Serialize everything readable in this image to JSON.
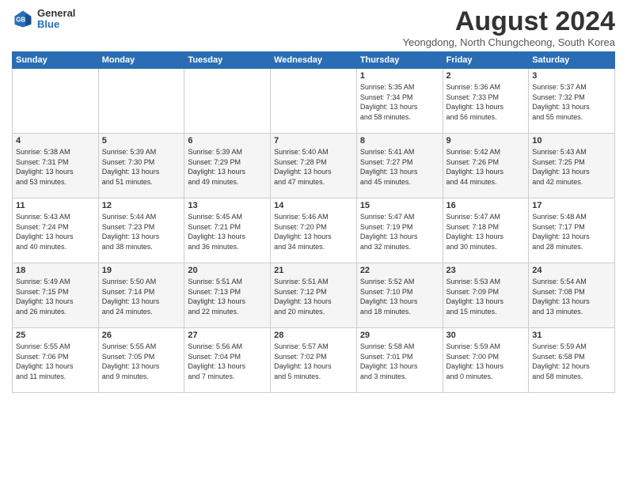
{
  "logo": {
    "general": "General",
    "blue": "Blue"
  },
  "header": {
    "title": "August 2024",
    "subtitle": "Yeongdong, North Chungcheong, South Korea"
  },
  "weekdays": [
    "Sunday",
    "Monday",
    "Tuesday",
    "Wednesday",
    "Thursday",
    "Friday",
    "Saturday"
  ],
  "weeks": [
    [
      {
        "day": "",
        "info": ""
      },
      {
        "day": "",
        "info": ""
      },
      {
        "day": "",
        "info": ""
      },
      {
        "day": "",
        "info": ""
      },
      {
        "day": "1",
        "info": "Sunrise: 5:35 AM\nSunset: 7:34 PM\nDaylight: 13 hours\nand 58 minutes."
      },
      {
        "day": "2",
        "info": "Sunrise: 5:36 AM\nSunset: 7:33 PM\nDaylight: 13 hours\nand 56 minutes."
      },
      {
        "day": "3",
        "info": "Sunrise: 5:37 AM\nSunset: 7:32 PM\nDaylight: 13 hours\nand 55 minutes."
      }
    ],
    [
      {
        "day": "4",
        "info": "Sunrise: 5:38 AM\nSunset: 7:31 PM\nDaylight: 13 hours\nand 53 minutes."
      },
      {
        "day": "5",
        "info": "Sunrise: 5:39 AM\nSunset: 7:30 PM\nDaylight: 13 hours\nand 51 minutes."
      },
      {
        "day": "6",
        "info": "Sunrise: 5:39 AM\nSunset: 7:29 PM\nDaylight: 13 hours\nand 49 minutes."
      },
      {
        "day": "7",
        "info": "Sunrise: 5:40 AM\nSunset: 7:28 PM\nDaylight: 13 hours\nand 47 minutes."
      },
      {
        "day": "8",
        "info": "Sunrise: 5:41 AM\nSunset: 7:27 PM\nDaylight: 13 hours\nand 45 minutes."
      },
      {
        "day": "9",
        "info": "Sunrise: 5:42 AM\nSunset: 7:26 PM\nDaylight: 13 hours\nand 44 minutes."
      },
      {
        "day": "10",
        "info": "Sunrise: 5:43 AM\nSunset: 7:25 PM\nDaylight: 13 hours\nand 42 minutes."
      }
    ],
    [
      {
        "day": "11",
        "info": "Sunrise: 5:43 AM\nSunset: 7:24 PM\nDaylight: 13 hours\nand 40 minutes."
      },
      {
        "day": "12",
        "info": "Sunrise: 5:44 AM\nSunset: 7:23 PM\nDaylight: 13 hours\nand 38 minutes."
      },
      {
        "day": "13",
        "info": "Sunrise: 5:45 AM\nSunset: 7:21 PM\nDaylight: 13 hours\nand 36 minutes."
      },
      {
        "day": "14",
        "info": "Sunrise: 5:46 AM\nSunset: 7:20 PM\nDaylight: 13 hours\nand 34 minutes."
      },
      {
        "day": "15",
        "info": "Sunrise: 5:47 AM\nSunset: 7:19 PM\nDaylight: 13 hours\nand 32 minutes."
      },
      {
        "day": "16",
        "info": "Sunrise: 5:47 AM\nSunset: 7:18 PM\nDaylight: 13 hours\nand 30 minutes."
      },
      {
        "day": "17",
        "info": "Sunrise: 5:48 AM\nSunset: 7:17 PM\nDaylight: 13 hours\nand 28 minutes."
      }
    ],
    [
      {
        "day": "18",
        "info": "Sunrise: 5:49 AM\nSunset: 7:15 PM\nDaylight: 13 hours\nand 26 minutes."
      },
      {
        "day": "19",
        "info": "Sunrise: 5:50 AM\nSunset: 7:14 PM\nDaylight: 13 hours\nand 24 minutes."
      },
      {
        "day": "20",
        "info": "Sunrise: 5:51 AM\nSunset: 7:13 PM\nDaylight: 13 hours\nand 22 minutes."
      },
      {
        "day": "21",
        "info": "Sunrise: 5:51 AM\nSunset: 7:12 PM\nDaylight: 13 hours\nand 20 minutes."
      },
      {
        "day": "22",
        "info": "Sunrise: 5:52 AM\nSunset: 7:10 PM\nDaylight: 13 hours\nand 18 minutes."
      },
      {
        "day": "23",
        "info": "Sunrise: 5:53 AM\nSunset: 7:09 PM\nDaylight: 13 hours\nand 15 minutes."
      },
      {
        "day": "24",
        "info": "Sunrise: 5:54 AM\nSunset: 7:08 PM\nDaylight: 13 hours\nand 13 minutes."
      }
    ],
    [
      {
        "day": "25",
        "info": "Sunrise: 5:55 AM\nSunset: 7:06 PM\nDaylight: 13 hours\nand 11 minutes."
      },
      {
        "day": "26",
        "info": "Sunrise: 5:55 AM\nSunset: 7:05 PM\nDaylight: 13 hours\nand 9 minutes."
      },
      {
        "day": "27",
        "info": "Sunrise: 5:56 AM\nSunset: 7:04 PM\nDaylight: 13 hours\nand 7 minutes."
      },
      {
        "day": "28",
        "info": "Sunrise: 5:57 AM\nSunset: 7:02 PM\nDaylight: 13 hours\nand 5 minutes."
      },
      {
        "day": "29",
        "info": "Sunrise: 5:58 AM\nSunset: 7:01 PM\nDaylight: 13 hours\nand 3 minutes."
      },
      {
        "day": "30",
        "info": "Sunrise: 5:59 AM\nSunset: 7:00 PM\nDaylight: 13 hours\nand 0 minutes."
      },
      {
        "day": "31",
        "info": "Sunrise: 5:59 AM\nSunset: 6:58 PM\nDaylight: 12 hours\nand 58 minutes."
      }
    ]
  ]
}
